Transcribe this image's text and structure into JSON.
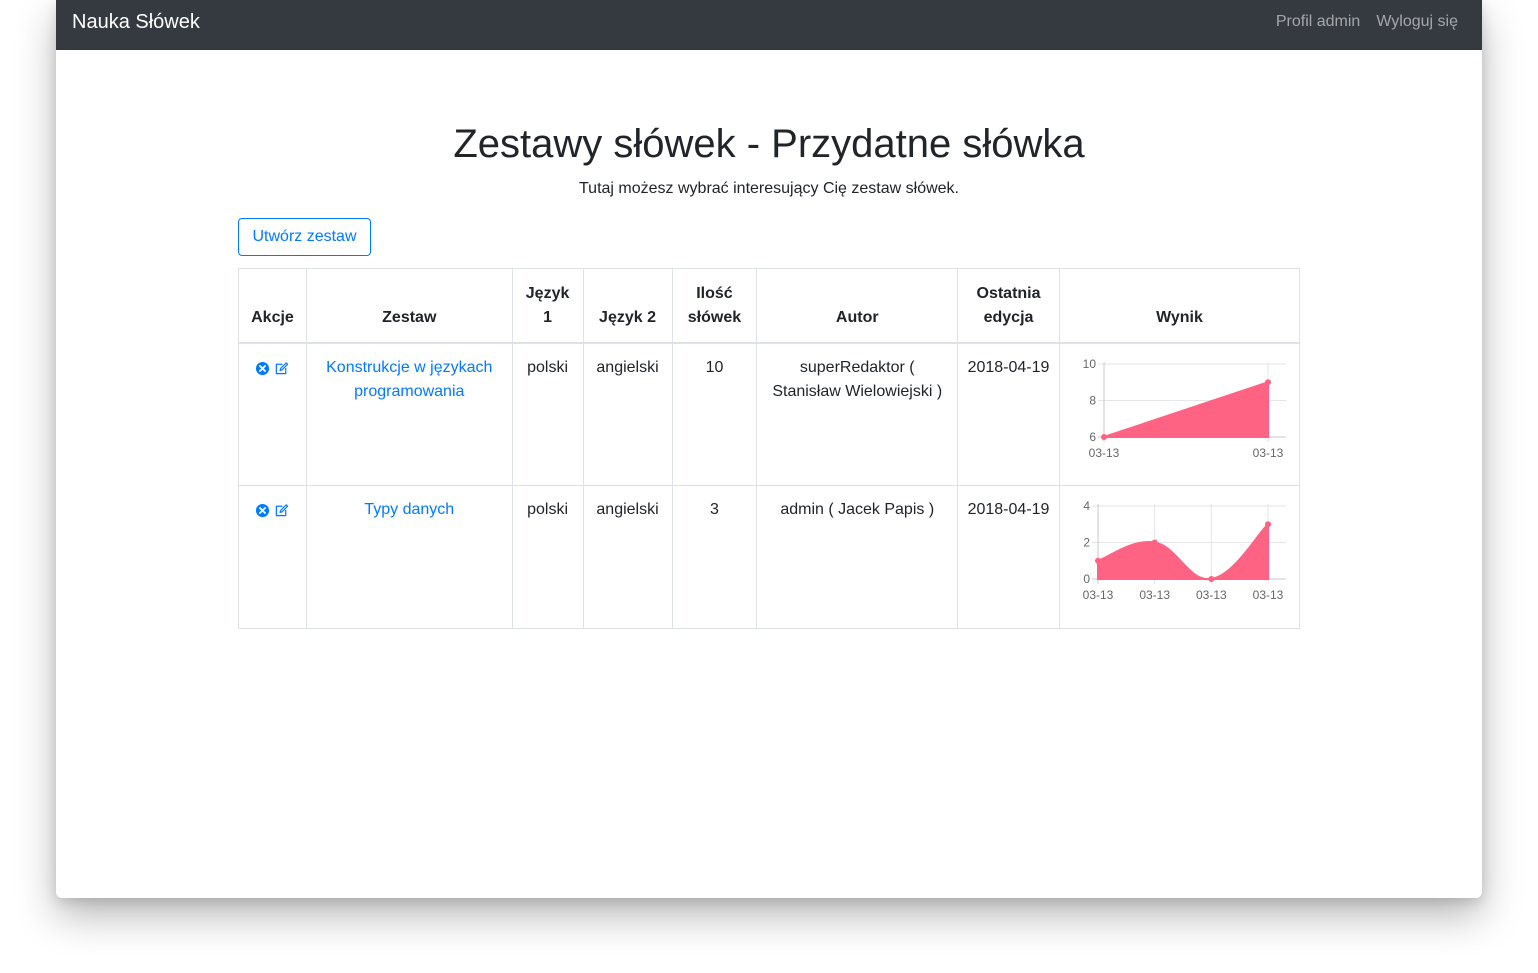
{
  "navbar": {
    "brand": "Nauka Słówek",
    "links": [
      "Profil admin",
      "Wyloguj się"
    ]
  },
  "page": {
    "title": "Zestawy słówek - Przydatne słówka",
    "subtitle": "Tutaj możesz wybrać interesujący Cię zestaw słówek.",
    "create_button": "Utwórz zestaw"
  },
  "table": {
    "headers": [
      "Akcje",
      "Zestaw",
      "Język 1",
      "Język 2",
      "Ilość słówek",
      "Autor",
      "Ostatnia edycja",
      "Wynik"
    ],
    "rows": [
      {
        "name": "Konstrukcje w językach programowania",
        "lang1": "polski",
        "lang2": "angielski",
        "count": "10",
        "author": "superRedaktor ( Stanisław Wielowiejski )",
        "edited": "2018-04-19"
      },
      {
        "name": "Typy danych",
        "lang1": "polski",
        "lang2": "angielski",
        "count": "3",
        "author": "admin ( Jacek Papis )",
        "edited": "2018-04-19"
      }
    ]
  },
  "icons": {
    "delete": "times-circle-icon",
    "edit": "edit-icon"
  },
  "colors": {
    "accent": "#007bff",
    "navbar": "#343a40",
    "chart_fill": "#ff6384"
  },
  "chart_data": [
    {
      "type": "area",
      "x": [
        "03-13",
        "03-13"
      ],
      "series": [
        {
          "values": [
            6,
            9
          ]
        }
      ],
      "yticks": [
        6,
        8,
        10
      ],
      "ylim": [
        6,
        10
      ],
      "grid": true
    },
    {
      "type": "area",
      "x": [
        "03-13",
        "03-13",
        "03-13",
        "03-13"
      ],
      "series": [
        {
          "values": [
            1,
            2,
            0,
            3
          ]
        }
      ],
      "yticks": [
        0,
        2,
        4
      ],
      "ylim": [
        0,
        4
      ],
      "grid": true
    }
  ]
}
